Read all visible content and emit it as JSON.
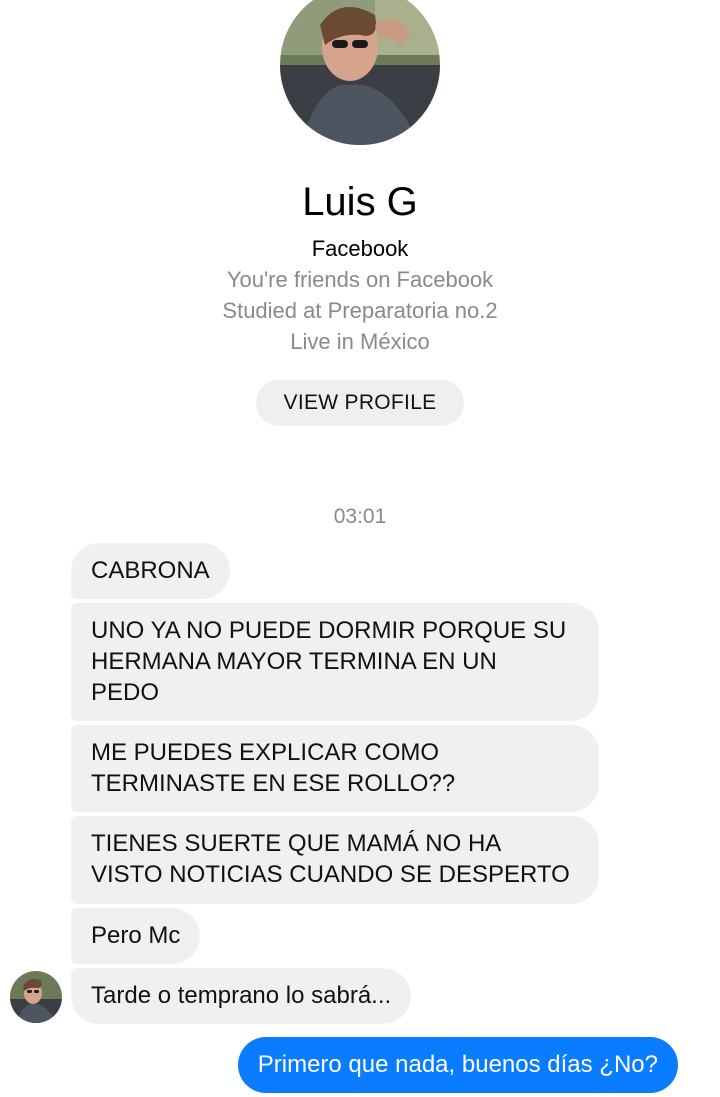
{
  "profile": {
    "name": "Luis G",
    "source": "Facebook",
    "details": [
      "You're friends on Facebook",
      "Studied at Preparatoria no.2",
      "Live in México"
    ],
    "view_profile_label": "VIEW PROFILE"
  },
  "conversation": {
    "timestamp": "03:01",
    "incoming": [
      "CABRONA",
      "UNO YA NO PUEDE DORMIR PORQUE SU\nHERMANA MAYOR TERMINA EN UN\nPEDO",
      "ME PUEDES EXPLICAR COMO\nTERMINASTE EN ESE ROLLO??",
      "TIENES SUERTE QUE MAMÁ NO HA\nVISTO NOTICIAS CUANDO SE DESPERTO",
      "Pero Mc",
      "Tarde o temprano lo sabrá..."
    ],
    "outgoing": [
      "Primero que nada, buenos días ¿No?"
    ]
  },
  "colors": {
    "incoming_bubble": "#f0f0f0",
    "outgoing_bubble": "#0a7cff",
    "secondary_text": "#8a8a8a"
  }
}
